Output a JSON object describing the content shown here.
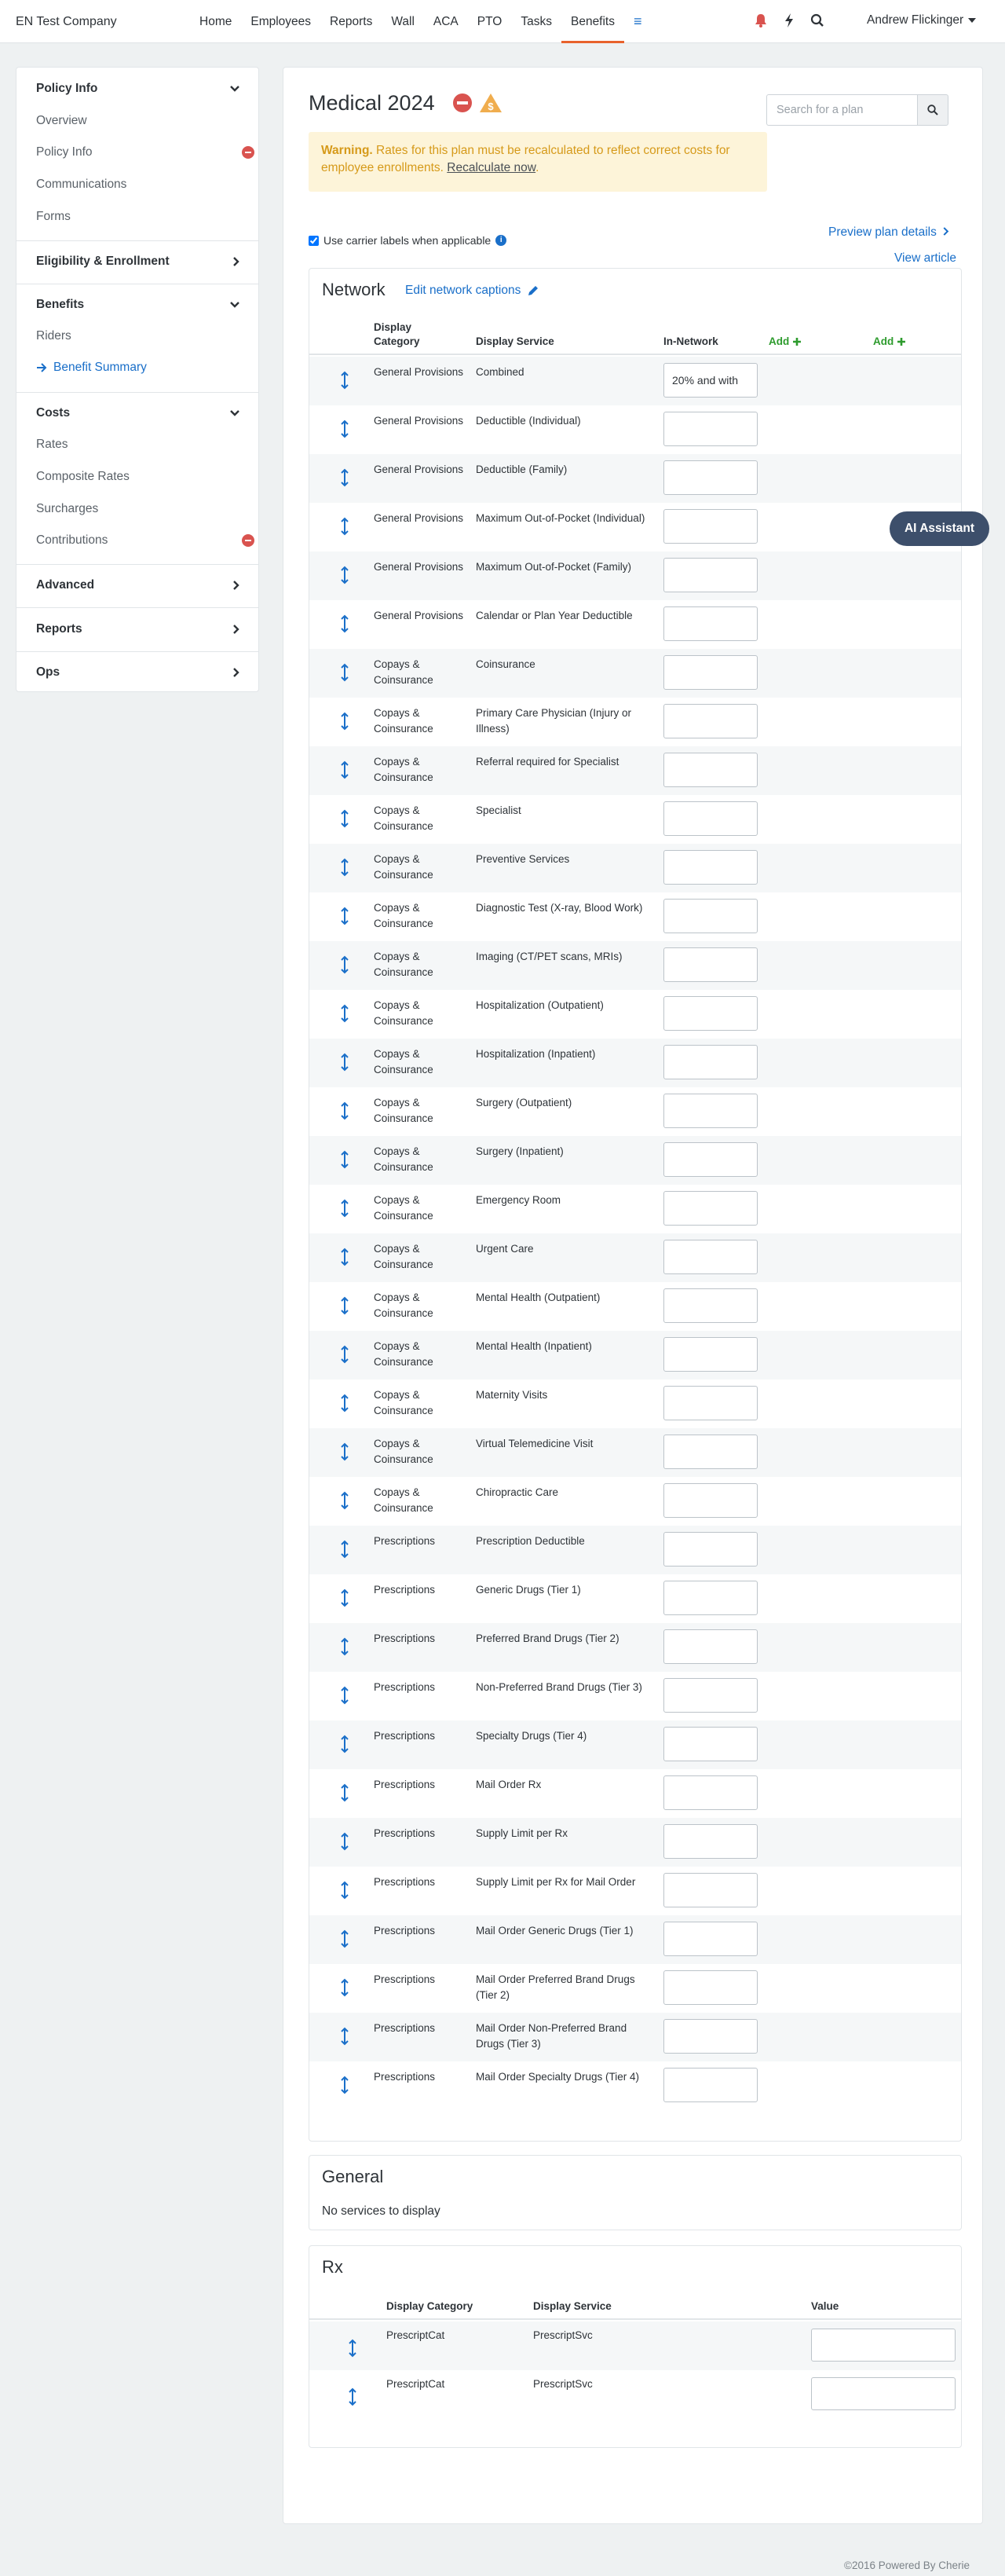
{
  "topbar": {
    "company": "EN Test Company",
    "nav": [
      "Home",
      "Employees",
      "Reports",
      "Wall",
      "ACA",
      "PTO",
      "Tasks",
      "Benefits"
    ],
    "active_nav": "Benefits",
    "user": "Andrew Flickinger"
  },
  "sidebar": {
    "policy_info": "Policy Info",
    "policy_items": [
      "Overview",
      "Policy Info",
      "Communications",
      "Forms"
    ],
    "eligibility": "Eligibility & Enrollment",
    "benefits": "Benefits",
    "benefits_items": [
      "Riders",
      "Benefit Summary"
    ],
    "costs": "Costs",
    "costs_items": [
      "Rates",
      "Composite Rates",
      "Surcharges",
      "Contributions"
    ],
    "advanced": "Advanced",
    "reports": "Reports",
    "ops": "Ops"
  },
  "main": {
    "title": "Medical 2024",
    "search_placeholder": "Search for a plan",
    "warning_label": "Warning.",
    "warning_text": "Rates for this plan must be recalculated to reflect correct costs for employee enrollments.",
    "recalculate": "Recalculate now",
    "carrier_labels": "Use carrier labels when applicable",
    "preview_plan": "Preview plan details",
    "view_article": "View article"
  },
  "network": {
    "title": "Network",
    "edit_captions": "Edit network captions",
    "headers": {
      "category": "Display Category",
      "service": "Display Service",
      "in_network": "In-Network",
      "add1": "Add",
      "add2": "Add"
    },
    "rows": [
      {
        "category": "General Provisions",
        "service": "Combined",
        "value": "20% and with"
      },
      {
        "category": "General Provisions",
        "service": "Deductible (Individual)",
        "value": ""
      },
      {
        "category": "General Provisions",
        "service": "Deductible (Family)",
        "value": ""
      },
      {
        "category": "General Provisions",
        "service": "Maximum Out-of-Pocket (Individual)",
        "value": ""
      },
      {
        "category": "General Provisions",
        "service": "Maximum Out-of-Pocket (Family)",
        "value": ""
      },
      {
        "category": "General Provisions",
        "service": "Calendar or Plan Year Deductible",
        "value": ""
      },
      {
        "category": "Copays & Coinsurance",
        "service": "Coinsurance",
        "value": ""
      },
      {
        "category": "Copays & Coinsurance",
        "service": "Primary Care Physician (Injury or Illness)",
        "value": ""
      },
      {
        "category": "Copays & Coinsurance",
        "service": "Referral required for Specialist",
        "value": ""
      },
      {
        "category": "Copays & Coinsurance",
        "service": "Specialist",
        "value": ""
      },
      {
        "category": "Copays & Coinsurance",
        "service": "Preventive Services",
        "value": ""
      },
      {
        "category": "Copays & Coinsurance",
        "service": "Diagnostic Test (X-ray, Blood Work)",
        "value": ""
      },
      {
        "category": "Copays & Coinsurance",
        "service": "Imaging (CT/PET scans, MRIs)",
        "value": ""
      },
      {
        "category": "Copays & Coinsurance",
        "service": "Hospitalization (Outpatient)",
        "value": ""
      },
      {
        "category": "Copays & Coinsurance",
        "service": "Hospitalization (Inpatient)",
        "value": ""
      },
      {
        "category": "Copays & Coinsurance",
        "service": "Surgery (Outpatient)",
        "value": ""
      },
      {
        "category": "Copays & Coinsurance",
        "service": "Surgery (Inpatient)",
        "value": ""
      },
      {
        "category": "Copays & Coinsurance",
        "service": "Emergency Room",
        "value": ""
      },
      {
        "category": "Copays & Coinsurance",
        "service": "Urgent Care",
        "value": ""
      },
      {
        "category": "Copays & Coinsurance",
        "service": "Mental Health (Outpatient)",
        "value": ""
      },
      {
        "category": "Copays & Coinsurance",
        "service": "Mental Health (Inpatient)",
        "value": ""
      },
      {
        "category": "Copays & Coinsurance",
        "service": "Maternity Visits",
        "value": ""
      },
      {
        "category": "Copays & Coinsurance",
        "service": "Virtual Telemedicine Visit",
        "value": ""
      },
      {
        "category": "Copays & Coinsurance",
        "service": "Chiropractic Care",
        "value": ""
      },
      {
        "category": "Prescriptions",
        "service": "Prescription Deductible",
        "value": ""
      },
      {
        "category": "Prescriptions",
        "service": "Generic Drugs (Tier 1)",
        "value": ""
      },
      {
        "category": "Prescriptions",
        "service": "Preferred Brand Drugs (Tier 2)",
        "value": ""
      },
      {
        "category": "Prescriptions",
        "service": "Non-Preferred Brand Drugs (Tier 3)",
        "value": ""
      },
      {
        "category": "Prescriptions",
        "service": "Specialty Drugs (Tier 4)",
        "value": ""
      },
      {
        "category": "Prescriptions",
        "service": "Mail Order Rx",
        "value": ""
      },
      {
        "category": "Prescriptions",
        "service": "Supply Limit per Rx",
        "value": ""
      },
      {
        "category": "Prescriptions",
        "service": "Supply Limit per Rx for Mail Order",
        "value": ""
      },
      {
        "category": "Prescriptions",
        "service": "Mail Order Generic Drugs (Tier 1)",
        "value": ""
      },
      {
        "category": "Prescriptions",
        "service": "Mail Order Preferred Brand Drugs (Tier 2)",
        "value": ""
      },
      {
        "category": "Prescriptions",
        "service": "Mail Order Non-Preferred Brand Drugs (Tier 3)",
        "value": ""
      },
      {
        "category": "Prescriptions",
        "service": "Mail Order Specialty Drugs (Tier 4)",
        "value": ""
      }
    ]
  },
  "general": {
    "title": "General",
    "empty": "No services to display"
  },
  "rx": {
    "title": "Rx",
    "headers": {
      "category": "Display Category",
      "service": "Display Service",
      "value": "Value"
    },
    "rows": [
      {
        "category": "PrescriptCat",
        "service": "PrescriptSvc",
        "value": ""
      },
      {
        "category": "PrescriptCat",
        "service": "PrescriptSvc",
        "value": ""
      }
    ]
  },
  "ai_assistant": "AI Assistant",
  "footer": "©2016 Powered By Cherie",
  "colors": {
    "accent": "#1a6fc9",
    "active_underline": "#e8622c",
    "danger": "#d9534f",
    "warning_bg": "#fdf4d9",
    "add_green": "#2d9b2d"
  }
}
